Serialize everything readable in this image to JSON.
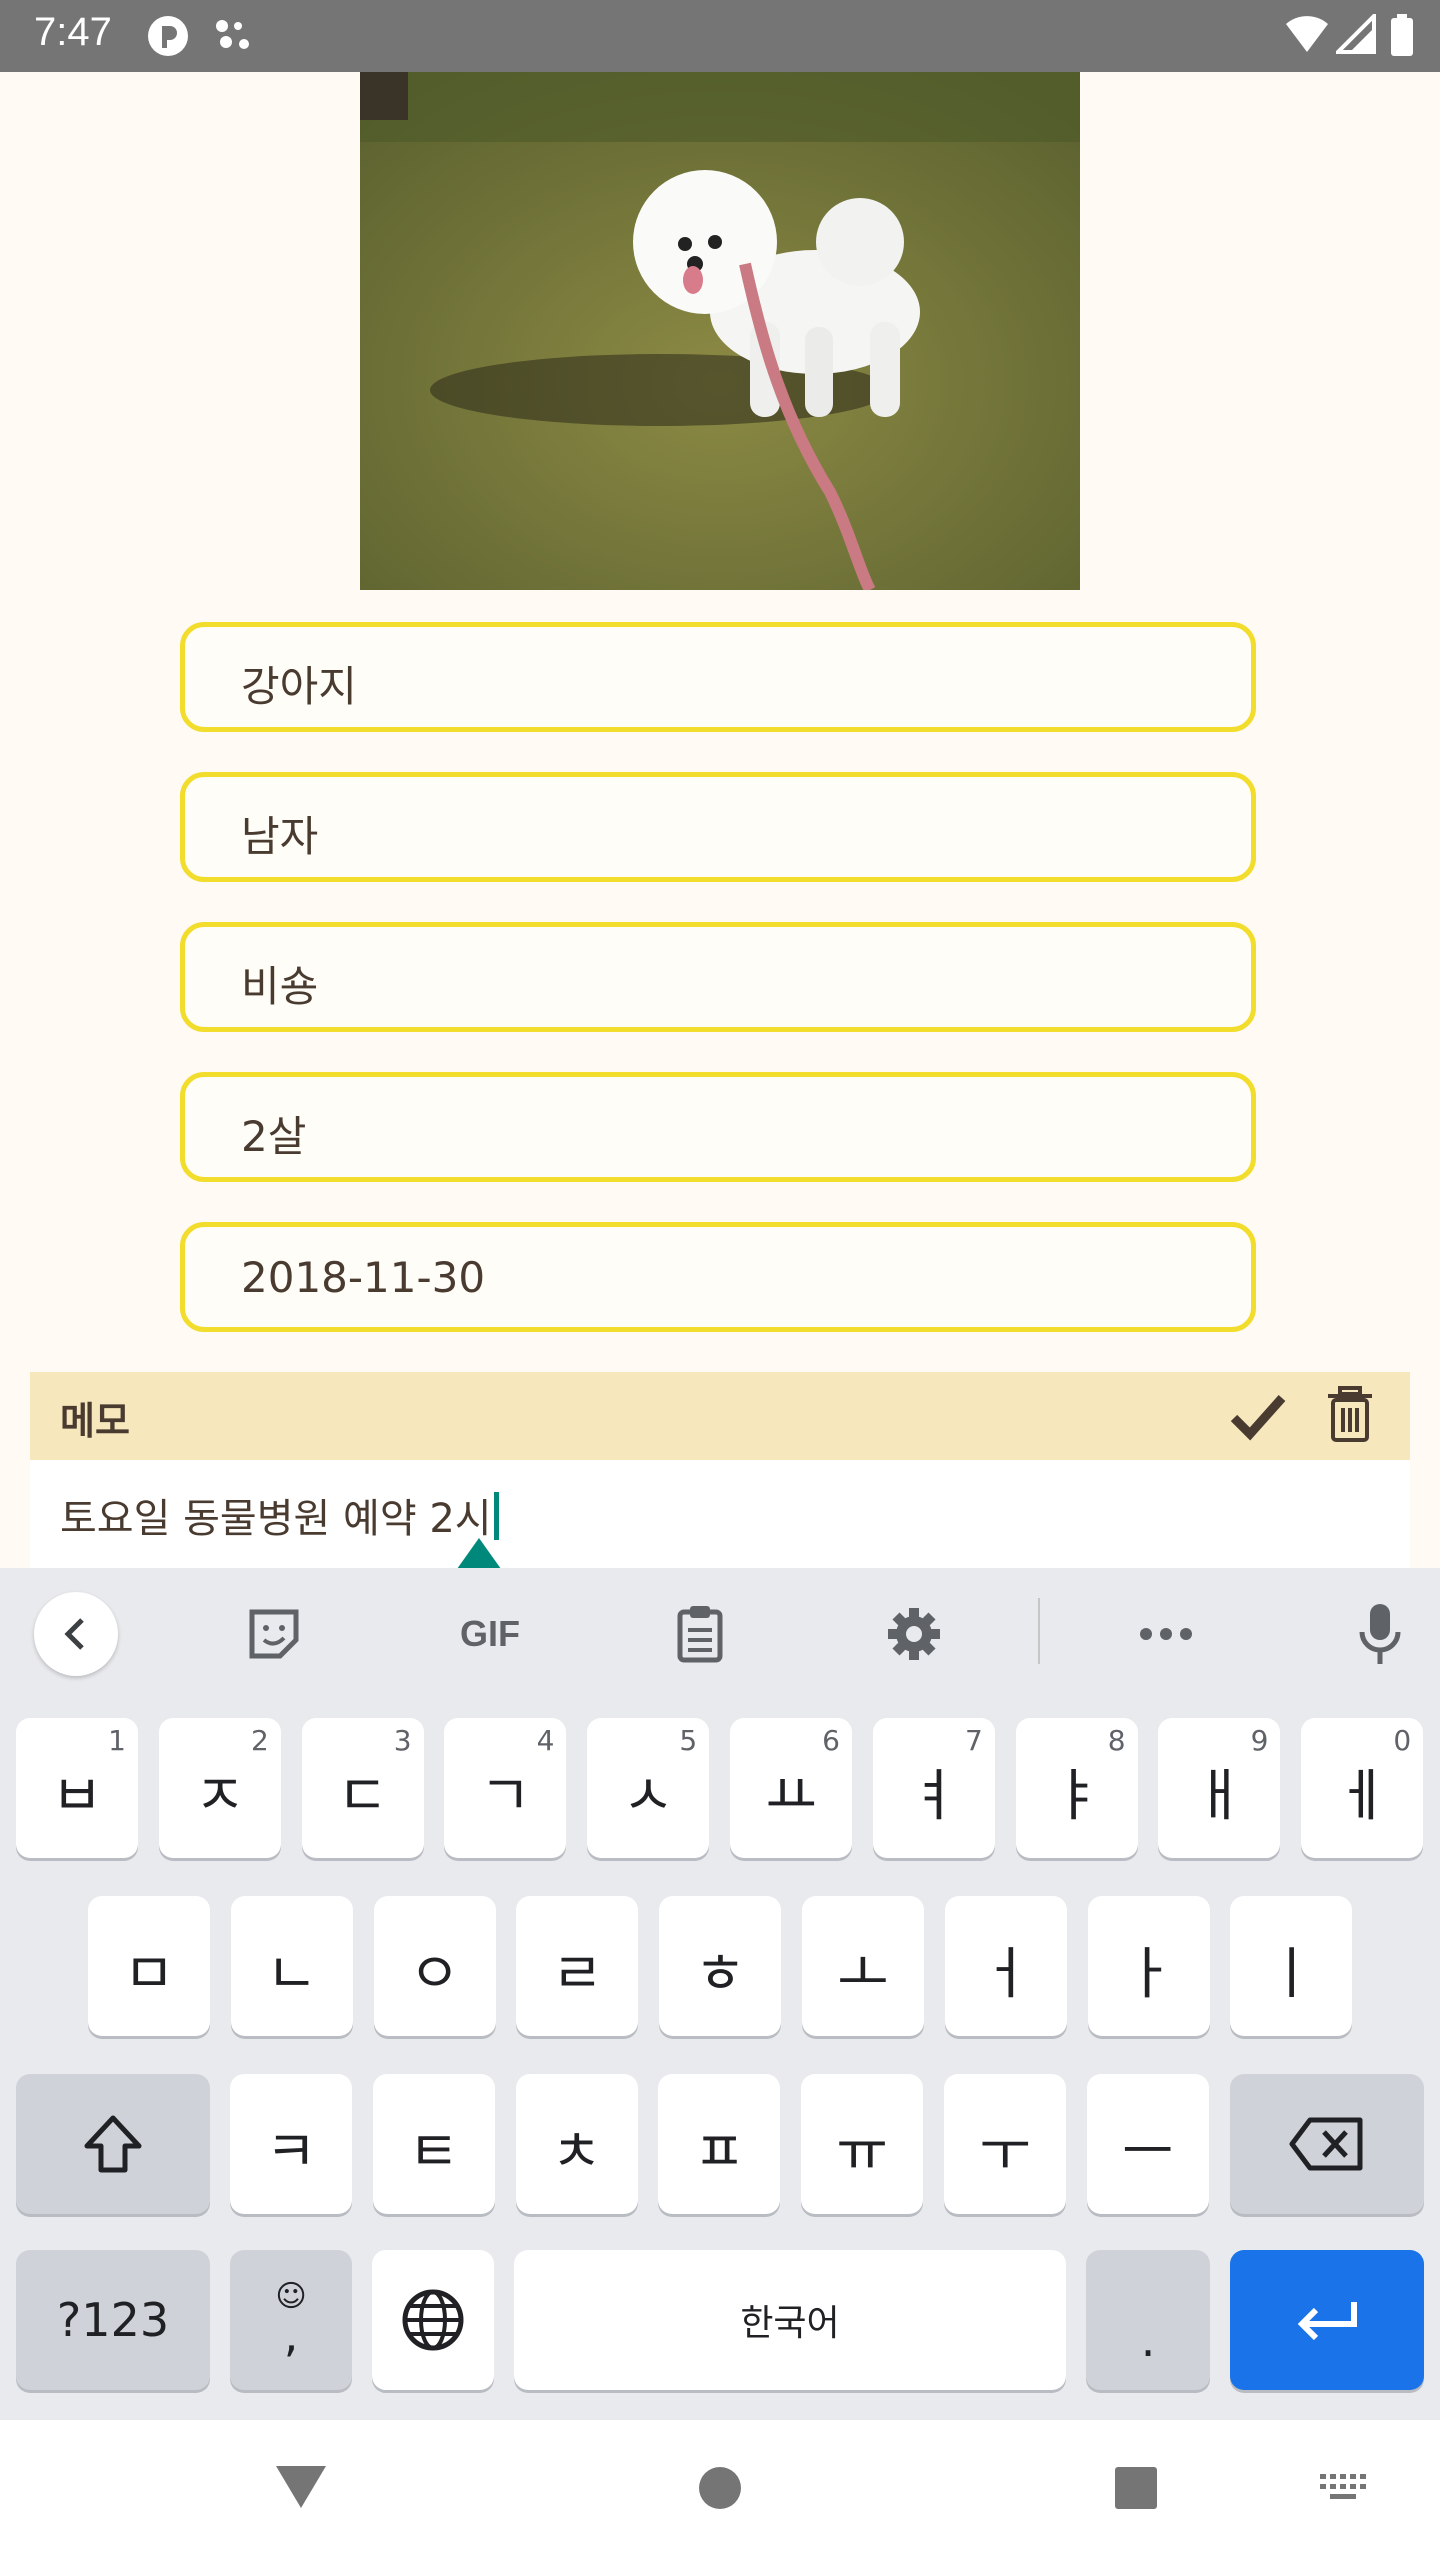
{
  "status_bar": {
    "time": "7:47"
  },
  "fields": [
    "강아지",
    "남자",
    "비숑",
    "2살",
    "2018-11-30"
  ],
  "memo": {
    "title": "메모",
    "text": "토요일 동물병원 예약 2시"
  },
  "keyboard": {
    "toolbar": {
      "gif_label": "GIF"
    },
    "row1": [
      {
        "key": "ㅂ",
        "hint": "1"
      },
      {
        "key": "ㅈ",
        "hint": "2"
      },
      {
        "key": "ㄷ",
        "hint": "3"
      },
      {
        "key": "ㄱ",
        "hint": "4"
      },
      {
        "key": "ㅅ",
        "hint": "5"
      },
      {
        "key": "ㅛ",
        "hint": "6"
      },
      {
        "key": "ㅕ",
        "hint": "7"
      },
      {
        "key": "ㅑ",
        "hint": "8"
      },
      {
        "key": "ㅐ",
        "hint": "9"
      },
      {
        "key": "ㅔ",
        "hint": "0"
      }
    ],
    "row2": [
      "ㅁ",
      "ㄴ",
      "ㅇ",
      "ㄹ",
      "ㅎ",
      "ㅗ",
      "ㅓ",
      "ㅏ",
      "ㅣ"
    ],
    "row3": [
      "ㅋ",
      "ㅌ",
      "ㅊ",
      "ㅍ",
      "ㅠ",
      "ㅜ",
      "ㅡ"
    ],
    "symbols_label": "?123",
    "comma_label": ",",
    "space_label": "한국어",
    "period_label": "."
  }
}
